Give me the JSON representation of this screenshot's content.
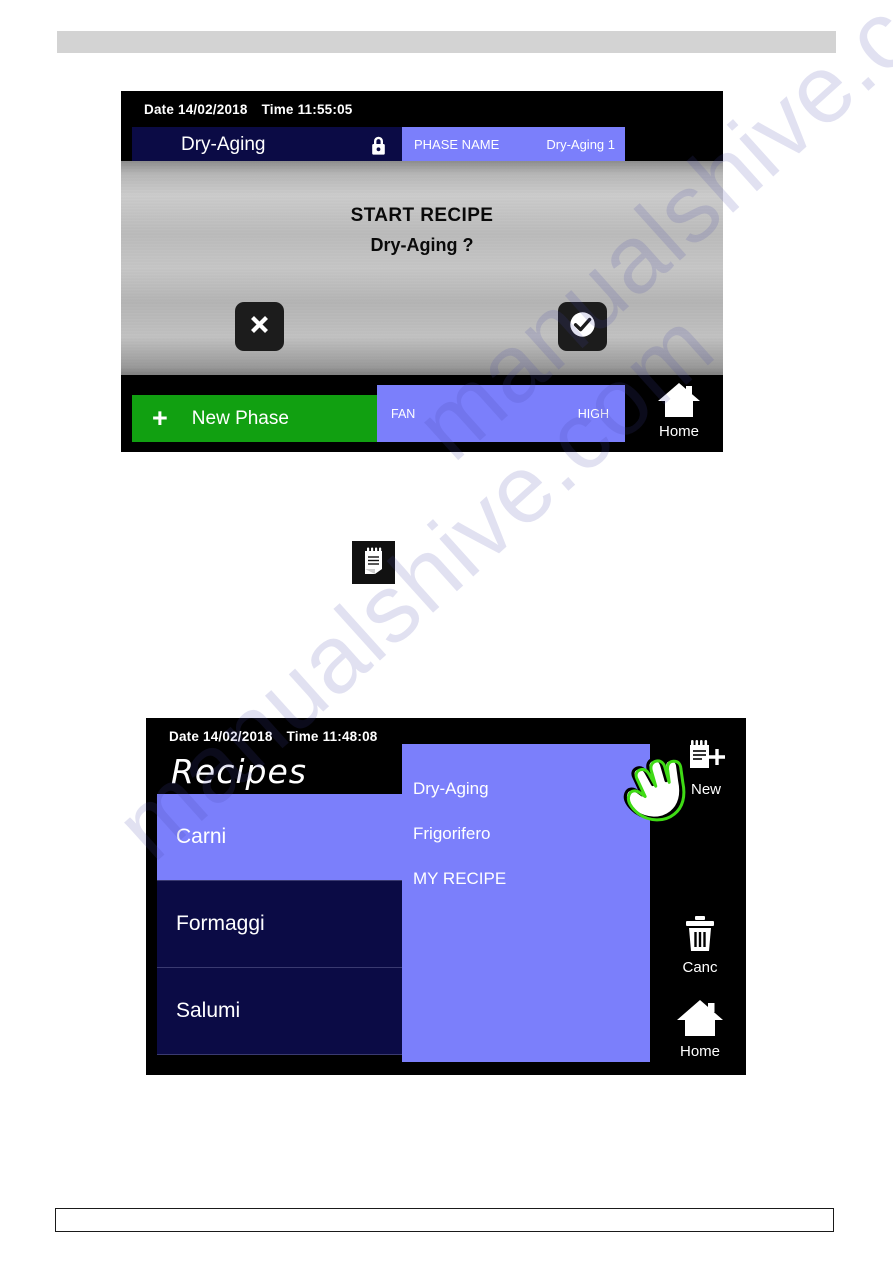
{
  "page": {
    "header_bar": "",
    "footer_box": "",
    "watermark_text": "manualshive.com"
  },
  "colors": {
    "purple": "#7b7ffb",
    "navy": "#0b0b45",
    "green": "#11a011",
    "black": "#000000",
    "white": "#ffffff",
    "metal_gray": "#c4c4c4",
    "page_header_gray": "#d3d3d3"
  },
  "screen_one": {
    "status": {
      "date_label": "Date 14/02/2018",
      "time_label": "Time 11:55:05"
    },
    "recipe_bar": {
      "name": "Dry-Aging",
      "lock_icon": "lock-icon"
    },
    "phase_bar": {
      "label": "PHASE NAME",
      "value": "Dry-Aging 1"
    },
    "dialog": {
      "title": "START RECIPE",
      "subtitle": "Dry-Aging ?",
      "cancel_icon": "close-x-icon",
      "confirm_icon": "check-circle-icon"
    },
    "bottom": {
      "new_phase_plus": "+",
      "new_phase_label": "New Phase",
      "fan_label": "FAN",
      "fan_value": "HIGH",
      "home_icon": "home-icon",
      "home_label": "Home"
    }
  },
  "inline_icon": {
    "name": "notepad-icon"
  },
  "screen_two": {
    "status": {
      "date_label": "Date 14/02/2018",
      "time_label": "Time 11:48:08"
    },
    "title": "Recipes",
    "categories": [
      {
        "label": "Carni",
        "selected": true
      },
      {
        "label": "Formaggi",
        "selected": false
      },
      {
        "label": "Salumi",
        "selected": false
      }
    ],
    "recipes": [
      {
        "label": "Dry-Aging"
      },
      {
        "label": "Frigorifero"
      },
      {
        "label": "MY RECIPE"
      }
    ],
    "side_buttons": [
      {
        "icon": "new-recipe-icon",
        "label": "New"
      },
      {
        "icon": "trash-icon",
        "label": "Canc"
      },
      {
        "icon": "home-icon",
        "label": "Home"
      }
    ],
    "cursor": {
      "icon": "hand-pointer-icon"
    }
  }
}
